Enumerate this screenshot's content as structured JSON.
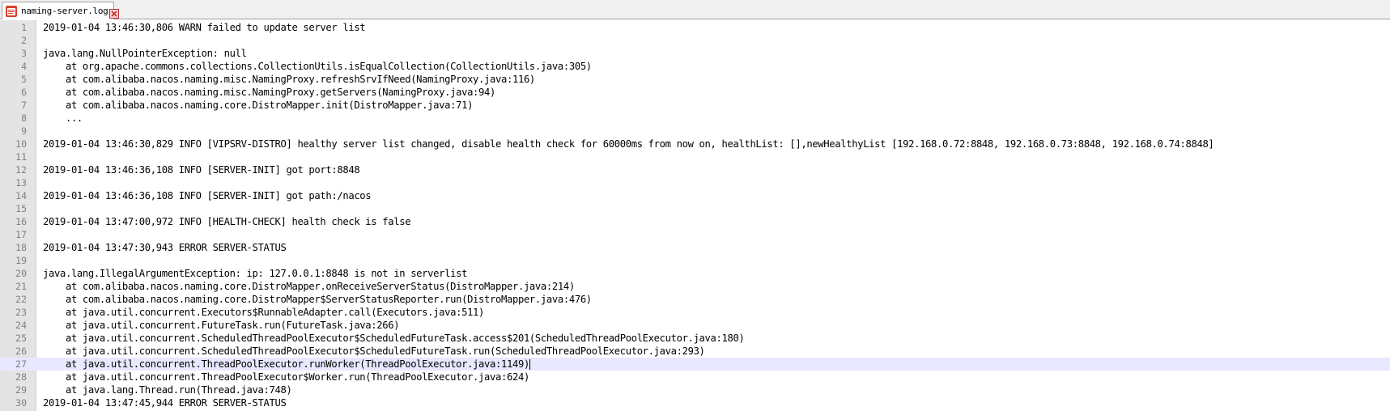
{
  "tab": {
    "filename": "naming-server.log",
    "file_icon": "notepad-file-icon",
    "close_icon": "close-icon"
  },
  "editor": {
    "current_line": 27,
    "current_line_color": "#e8e8ff",
    "lines": [
      {
        "number": "1",
        "text": "2019-01-04 13:46:30,806 WARN failed to update server list"
      },
      {
        "number": "2",
        "text": ""
      },
      {
        "number": "3",
        "text": "java.lang.NullPointerException: null"
      },
      {
        "number": "4",
        "text": "    at org.apache.commons.collections.CollectionUtils.isEqualCollection(CollectionUtils.java:305)"
      },
      {
        "number": "5",
        "text": "    at com.alibaba.nacos.naming.misc.NamingProxy.refreshSrvIfNeed(NamingProxy.java:116)"
      },
      {
        "number": "6",
        "text": "    at com.alibaba.nacos.naming.misc.NamingProxy.getServers(NamingProxy.java:94)"
      },
      {
        "number": "7",
        "text": "    at com.alibaba.nacos.naming.core.DistroMapper.init(DistroMapper.java:71)"
      },
      {
        "number": "8",
        "text": "    ..."
      },
      {
        "number": "9",
        "text": ""
      },
      {
        "number": "10",
        "text": "2019-01-04 13:46:30,829 INFO [VIPSRV-DISTRO] healthy server list changed, disable health check for 60000ms from now on, healthList: [],newHealthyList [192.168.0.72:8848, 192.168.0.73:8848, 192.168.0.74:8848]"
      },
      {
        "number": "11",
        "text": ""
      },
      {
        "number": "12",
        "text": "2019-01-04 13:46:36,108 INFO [SERVER-INIT] got port:8848"
      },
      {
        "number": "13",
        "text": ""
      },
      {
        "number": "14",
        "text": "2019-01-04 13:46:36,108 INFO [SERVER-INIT] got path:/nacos"
      },
      {
        "number": "15",
        "text": ""
      },
      {
        "number": "16",
        "text": "2019-01-04 13:47:00,972 INFO [HEALTH-CHECK] health check is false"
      },
      {
        "number": "17",
        "text": ""
      },
      {
        "number": "18",
        "text": "2019-01-04 13:47:30,943 ERROR SERVER-STATUS"
      },
      {
        "number": "19",
        "text": ""
      },
      {
        "number": "20",
        "text": "java.lang.IllegalArgumentException: ip: 127.0.0.1:8848 is not in serverlist"
      },
      {
        "number": "21",
        "text": "    at com.alibaba.nacos.naming.core.DistroMapper.onReceiveServerStatus(DistroMapper.java:214)"
      },
      {
        "number": "22",
        "text": "    at com.alibaba.nacos.naming.core.DistroMapper$ServerStatusReporter.run(DistroMapper.java:476)"
      },
      {
        "number": "23",
        "text": "    at java.util.concurrent.Executors$RunnableAdapter.call(Executors.java:511)"
      },
      {
        "number": "24",
        "text": "    at java.util.concurrent.FutureTask.run(FutureTask.java:266)"
      },
      {
        "number": "25",
        "text": "    at java.util.concurrent.ScheduledThreadPoolExecutor$ScheduledFutureTask.access$201(ScheduledThreadPoolExecutor.java:180)"
      },
      {
        "number": "26",
        "text": "    at java.util.concurrent.ScheduledThreadPoolExecutor$ScheduledFutureTask.run(ScheduledThreadPoolExecutor.java:293)"
      },
      {
        "number": "27",
        "text": "    at java.util.concurrent.ThreadPoolExecutor.runWorker(ThreadPoolExecutor.java:1149)"
      },
      {
        "number": "28",
        "text": "    at java.util.concurrent.ThreadPoolExecutor$Worker.run(ThreadPoolExecutor.java:624)"
      },
      {
        "number": "29",
        "text": "    at java.lang.Thread.run(Thread.java:748)"
      },
      {
        "number": "30",
        "text": "2019-01-04 13:47:45,944 ERROR SERVER-STATUS"
      }
    ]
  }
}
